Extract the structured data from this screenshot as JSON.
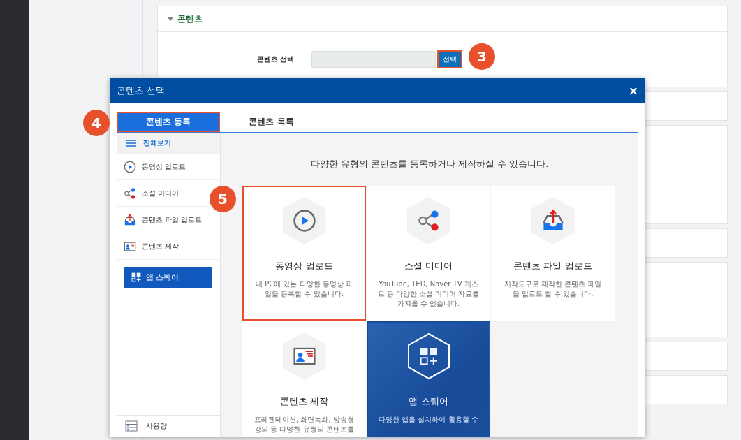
{
  "page": {
    "section_title": "콘텐츠",
    "content_label": "콘텐츠 선택",
    "select_button": "선택"
  },
  "annotations": [
    {
      "number": "3"
    },
    {
      "number": "4"
    },
    {
      "number": "5"
    }
  ],
  "modal": {
    "title": "콘텐츠 선택",
    "close": "×",
    "tabs": [
      {
        "label": "콘텐츠 등록",
        "selected": true
      },
      {
        "label": "콘텐츠 목록",
        "selected": false
      }
    ],
    "sidebar": {
      "view_all": "전체보기",
      "items": [
        {
          "label": "동영상 업로드",
          "kind": "video"
        },
        {
          "label": "소셜 미디어",
          "kind": "social"
        },
        {
          "label": "콘텐츠 파일 업로드",
          "kind": "file"
        },
        {
          "label": "콘텐츠 제작",
          "kind": "create"
        }
      ],
      "app_button": "앱 스퀘어",
      "usage": "사용량"
    },
    "heading": "다양한 유형의 콘텐츠를 등록하거나 제작하실 수 있습니다.",
    "cards": [
      {
        "kind": "video",
        "title": "동영상 업로드",
        "description": [
          "내 PC에 있는 다양한 동영상 파",
          "일을 등록할 수 있습니다."
        ],
        "selected": true
      },
      {
        "kind": "social",
        "title": "소셜 미디어",
        "description": [
          "YouTube, TED, Naver TV 캐스",
          "트 등 다양한 소셜 미디어 자료를",
          "가져올 수 있습니다."
        ],
        "selected": false
      },
      {
        "kind": "file",
        "title": "콘텐츠 파일 업로드",
        "description": [
          "저작도구로 제작한 콘텐츠 파일",
          "을 업로드 할 수 있습니다."
        ],
        "selected": false
      },
      {
        "kind": "create",
        "title": "콘텐츠 제작",
        "description": [
          "프레젠테이션, 화면녹화, 방송형",
          "강의 등 다양한 유형의 콘텐츠를"
        ],
        "selected": false
      },
      {
        "kind": "app",
        "title": "앱 스퀘어",
        "description": [
          "다양한 앱을 설치하여 활용할 수"
        ],
        "selected": false
      }
    ]
  }
}
